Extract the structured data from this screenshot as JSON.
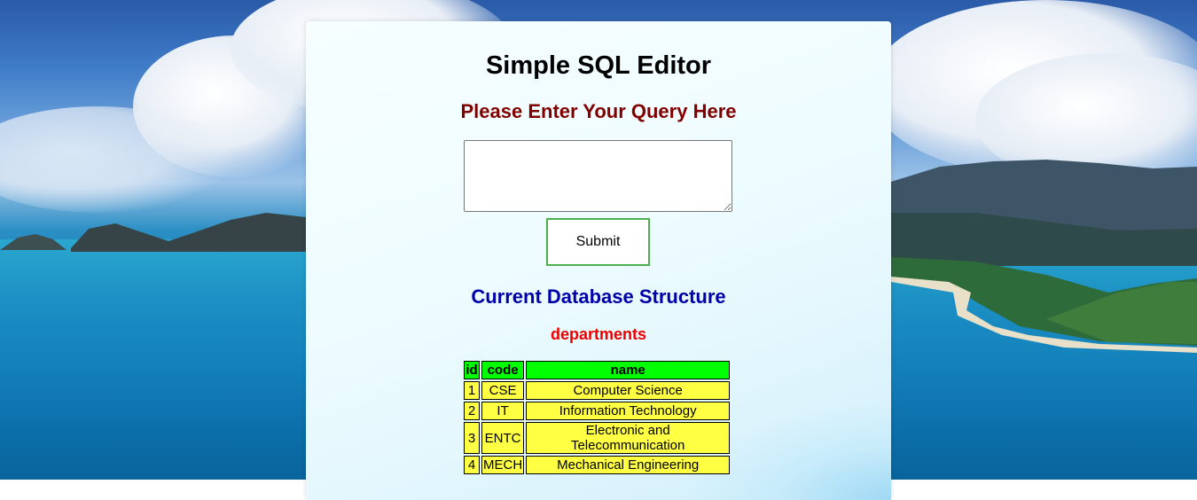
{
  "page": {
    "title": "Simple SQL Editor",
    "subtitle": "Please Enter Your Query Here"
  },
  "query_form": {
    "textarea_value": "",
    "submit_label": "Submit"
  },
  "database": {
    "section_title": "Current Database Structure",
    "tables": [
      {
        "name": "departments",
        "columns": [
          "id",
          "code",
          "name"
        ],
        "rows": [
          [
            "1",
            "CSE",
            "Computer Science"
          ],
          [
            "2",
            "IT",
            "Information Technology"
          ],
          [
            "3",
            "ENTC",
            "Electronic and Telecommunication"
          ],
          [
            "4",
            "MECH",
            "Mechanical Engineering"
          ]
        ]
      }
    ]
  },
  "colors": {
    "title": "#000000",
    "subtitle": "#800000",
    "section_title": "#0000aa",
    "table_name": "#ee0000",
    "header_bg": "#00ff00",
    "cell_bg": "#ffff44",
    "submit_border": "#4caf50"
  }
}
